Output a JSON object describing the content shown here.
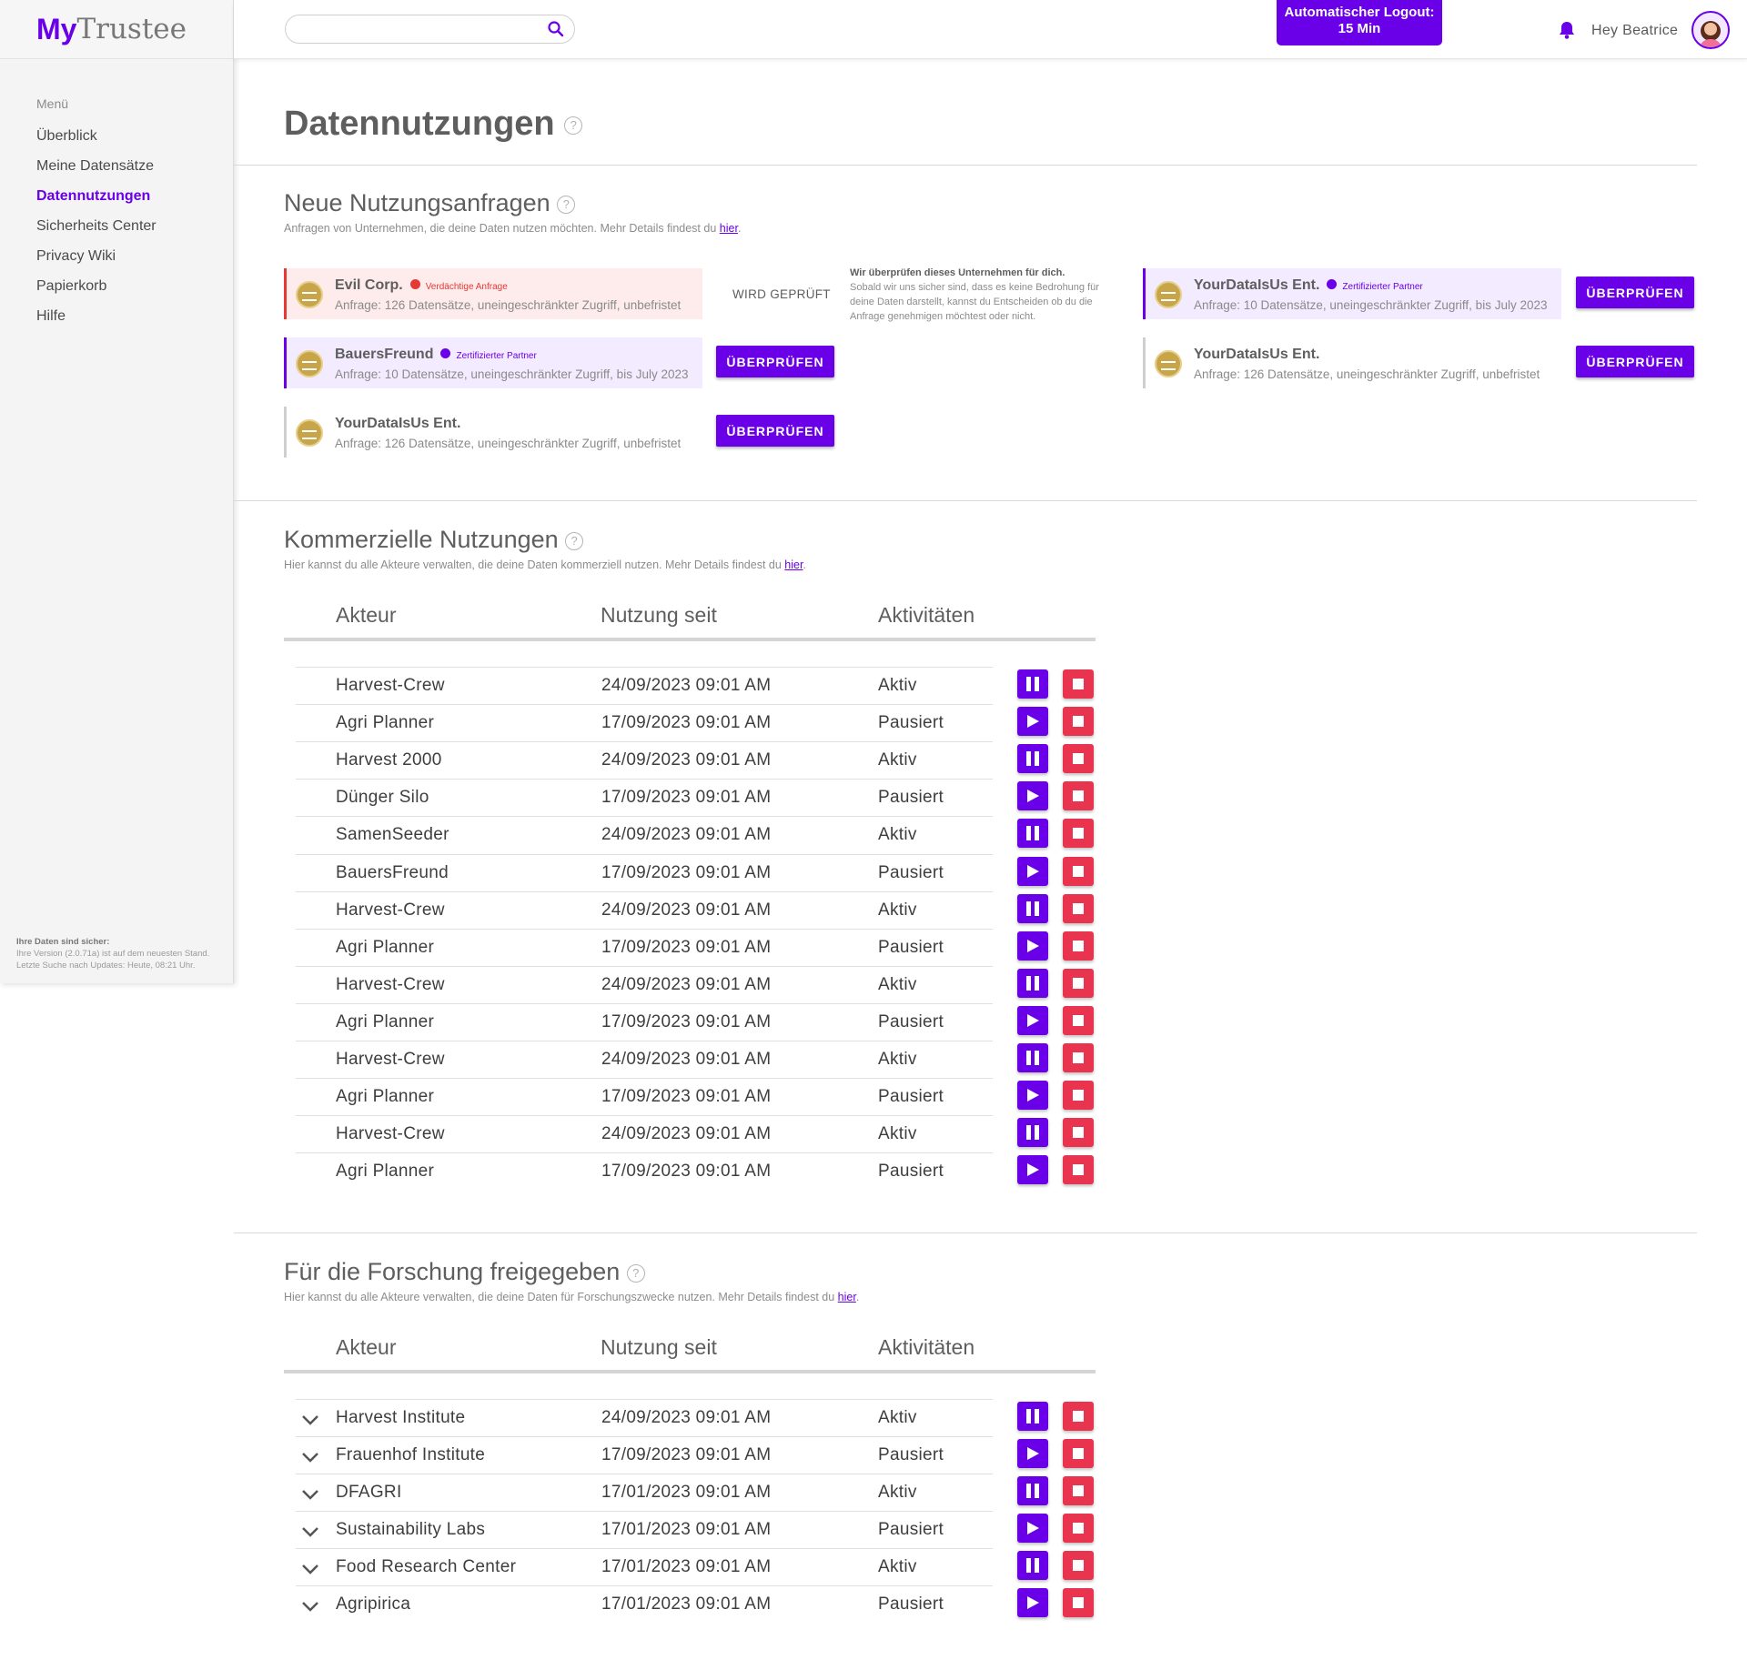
{
  "app": {
    "logo_my": "My",
    "logo_rest": "Trustee"
  },
  "sidebar": {
    "menu_title": "Menü",
    "items": [
      {
        "label": "Überblick",
        "active": false
      },
      {
        "label": "Meine Datensätze",
        "active": false
      },
      {
        "label": "Datennutzungen",
        "active": true
      },
      {
        "label": "Sicherheits Center",
        "active": false
      },
      {
        "label": "Privacy Wiki",
        "active": false
      },
      {
        "label": "Papierkorb",
        "active": false
      },
      {
        "label": "Hilfe",
        "active": false
      }
    ],
    "footer_title": "Ihre Daten sind sicher:",
    "footer_line1": "Ihre Version (2.0.71a) ist auf dem neuesten Stand.",
    "footer_line2": "Letzte Suche nach Updates: Heute, 08:21 Uhr."
  },
  "topbar": {
    "search_value": "",
    "logout_line1": "Automatischer Logout:",
    "logout_line2": "15 Min",
    "greeting": "Hey Beatrice"
  },
  "page": {
    "title": "Datennutzungen",
    "help": "?"
  },
  "requests": {
    "title": "Neue Nutzungsanfragen",
    "subtitle": "Anfragen von Unternehmen, die deine Daten nutzen möchten. Mehr Details findest du",
    "link": "hier",
    "checking_label": "WIRD GEPRÜFT",
    "checking_info_title": "Wir überprüfen dieses Unternehmen für dich.",
    "checking_info_text": "Sobald wir uns sicher sind, dass es keine Bedrohung für deine Daten darstellt, kannst du Entscheiden ob du die Anfrage genehmigen möchtest oder nicht.",
    "review_label": "ÜBERPRÜFEN",
    "cards": [
      {
        "name": "Evil Corp.",
        "tag": "Verdächtige Anfrage",
        "desc": "Anfrage: 126 Datensätze, uneingeschränkter Zugriff, unbefristet"
      },
      {
        "name": "BauersFreund",
        "tag": "Zertifizierter Partner",
        "desc": "Anfrage: 10 Datensätze, uneingeschränkter Zugriff, bis July 2023"
      },
      {
        "name": "YourDataIsUs Ent.",
        "tag": "",
        "desc": "Anfrage: 126 Datensätze, uneingeschränkter Zugriff, unbefristet"
      },
      {
        "name": "YourDataIsUs Ent.",
        "tag": "Zertifizierter Partner",
        "desc": "Anfrage: 10 Datensätze, uneingeschränkter Zugriff, bis July 2023"
      },
      {
        "name": "YourDataIsUs Ent.",
        "tag": "",
        "desc": "Anfrage: 126 Datensätze, uneingeschränkter Zugriff, unbefristet"
      }
    ]
  },
  "commercial": {
    "title": "Kommerzielle Nutzungen",
    "subtitle": "Hier kannst du alle Akteure verwalten, die deine Daten kommerziell nutzen. Mehr Details findest du",
    "link": "hier",
    "columns": [
      "Akteur",
      "Nutzung seit",
      "Aktivitäten"
    ],
    "rows": [
      {
        "actor": "Harvest-Crew",
        "since": "24/09/2023 09:01 AM",
        "status": "Aktiv"
      },
      {
        "actor": "Agri Planner",
        "since": "17/09/2023 09:01 AM",
        "status": "Pausiert"
      },
      {
        "actor": "Harvest 2000",
        "since": "24/09/2023 09:01 AM",
        "status": "Aktiv"
      },
      {
        "actor": "Dünger Silo",
        "since": "17/09/2023 09:01 AM",
        "status": "Pausiert"
      },
      {
        "actor": "SamenSeeder",
        "since": "24/09/2023 09:01 AM",
        "status": "Aktiv"
      },
      {
        "actor": "BauersFreund",
        "since": "17/09/2023 09:01 AM",
        "status": "Pausiert"
      },
      {
        "actor": "Harvest-Crew",
        "since": "24/09/2023 09:01 AM",
        "status": "Aktiv"
      },
      {
        "actor": "Agri Planner",
        "since": "17/09/2023 09:01 AM",
        "status": "Pausiert"
      },
      {
        "actor": "Harvest-Crew",
        "since": "24/09/2023 09:01 AM",
        "status": "Aktiv"
      },
      {
        "actor": "Agri Planner",
        "since": "17/09/2023 09:01 AM",
        "status": "Pausiert"
      },
      {
        "actor": "Harvest-Crew",
        "since": "24/09/2023 09:01 AM",
        "status": "Aktiv"
      },
      {
        "actor": "Agri Planner",
        "since": "17/09/2023 09:01 AM",
        "status": "Pausiert"
      },
      {
        "actor": "Harvest-Crew",
        "since": "24/09/2023 09:01 AM",
        "status": "Aktiv"
      },
      {
        "actor": "Agri Planner",
        "since": "17/09/2023 09:01 AM",
        "status": "Pausiert"
      }
    ]
  },
  "research": {
    "title": "Für die Forschung freigegeben",
    "subtitle": "Hier kannst du alle Akteure verwalten, die deine Daten für Forschungszwecke nutzen. Mehr Details findest du",
    "link": "hier",
    "columns": [
      "Akteur",
      "Nutzung seit",
      "Aktivitäten"
    ],
    "rows": [
      {
        "actor": "Harvest Institute",
        "since": "24/09/2023 09:01 AM",
        "status": "Aktiv"
      },
      {
        "actor": "Frauenhof Institute",
        "since": "17/09/2023 09:01 AM",
        "status": "Pausiert"
      },
      {
        "actor": "DFAGRI",
        "since": "17/01/2023 09:01 AM",
        "status": "Aktiv"
      },
      {
        "actor": "Sustainability Labs",
        "since": "17/01/2023 09:01 AM",
        "status": "Pausiert"
      },
      {
        "actor": "Food Research Center",
        "since": "17/01/2023 09:01 AM",
        "status": "Aktiv"
      },
      {
        "actor": "Agripirica",
        "since": "17/01/2023 09:01 AM",
        "status": "Pausiert"
      }
    ]
  },
  "colors": {
    "accent": "#6a00e8",
    "danger": "#e8344e",
    "warning": "#e53935"
  },
  "icons": {
    "search": "search-icon",
    "bell": "bell-icon",
    "pause": "pause-icon",
    "play": "play-icon",
    "stop": "stop-icon",
    "chevron": "chevron-down-icon"
  }
}
